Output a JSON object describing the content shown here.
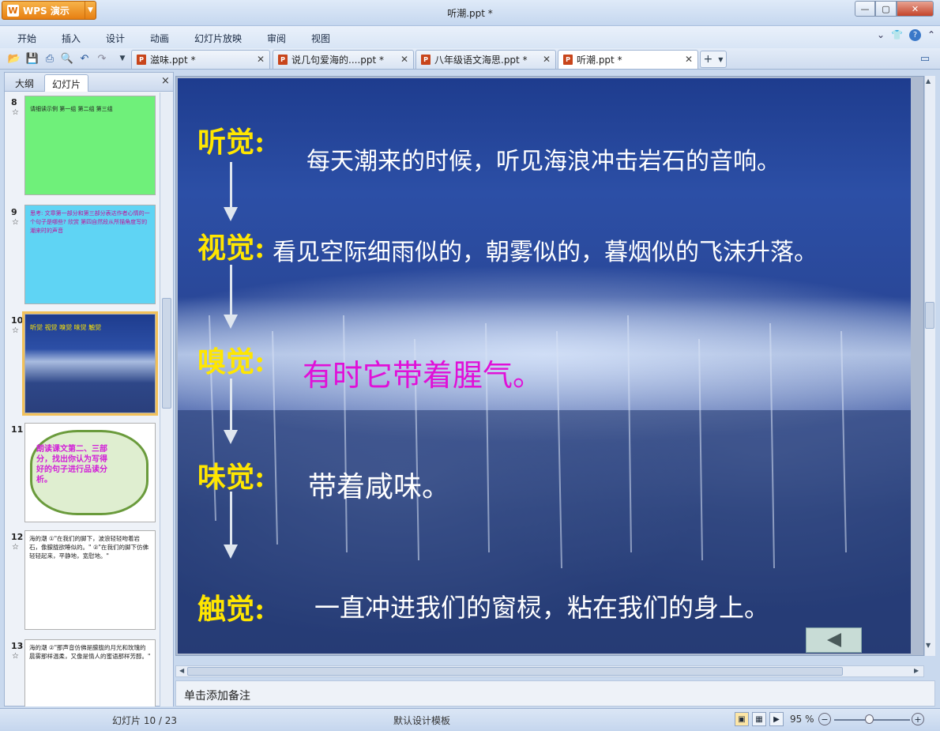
{
  "window": {
    "title": "听潮.ppt *",
    "app_button": "WPS 演示",
    "app_logo": "W"
  },
  "menu": [
    "开始",
    "插入",
    "设计",
    "动画",
    "幻灯片放映",
    "审阅",
    "视图"
  ],
  "doc_tabs": [
    {
      "label": "滋味.ppt *",
      "active": false
    },
    {
      "label": "说几句爱海的....ppt *",
      "active": false
    },
    {
      "label": "八年级语文海思.ppt *",
      "active": false
    },
    {
      "label": "听潮.ppt *",
      "active": true
    }
  ],
  "pane": {
    "tabs": [
      "大纲",
      "幻灯片"
    ],
    "close": "×",
    "slides": [
      {
        "num": "8",
        "text": "请细读示例 第一组 第二组 第三组"
      },
      {
        "num": "9",
        "text": "思考: 文章第一部分和第三部分表达作者心情的一个句子是哪些? 欣赏 第四自然段从所描角度写的潮来时的声音"
      },
      {
        "num": "10",
        "text": "听觉 视觉 嗅觉 味觉 触觉"
      },
      {
        "num": "11",
        "text": "朗读课文第二、三部分，找出你认为写得好的句子进行品读分析。"
      },
      {
        "num": "12",
        "text": "海的潮 ①\"在我们的脚下，波浪轻轻吻着岩石，像朦胧欲睡似的。\" ②\"在我们的脚下仿佛轻轻起来，平静地，宽慰地。\""
      },
      {
        "num": "13",
        "text": "海的潮 ②\"那声音仿佛是朦胧的月光和玫瑰的晨雾那样温柔，又像是情人的蜜语那样芳醇。\""
      }
    ]
  },
  "slide": {
    "rows": [
      {
        "sense": "听觉:",
        "text": "每天潮来的时候，听见海浪冲击岩石的音响。"
      },
      {
        "sense": "视觉:",
        "text": "看见空际细雨似的，朝雾似的，暮烟似的飞沫升落。"
      },
      {
        "sense": "嗅觉:",
        "text": "有时它带着腥气。"
      },
      {
        "sense": "味觉:",
        "text": "带着咸味。"
      },
      {
        "sense": "触觉:",
        "text": "一直冲进我们的窗棂，粘在我们的身上。"
      }
    ],
    "colors": {
      "sense": "#ffe600",
      "text": "#ffffff",
      "highlight": "#e010d8"
    }
  },
  "notes_placeholder": "单击添加备注",
  "status": {
    "slide_counter": "幻灯片 10 / 23",
    "template": "默认设计模板",
    "zoom": "95 %"
  }
}
